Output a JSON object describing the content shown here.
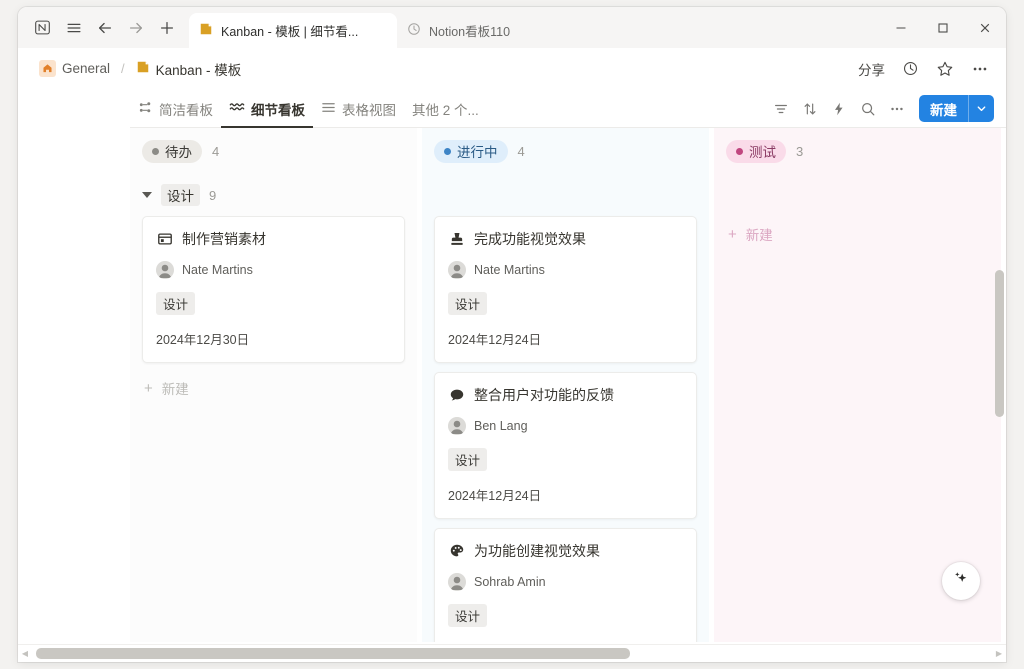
{
  "browser": {
    "nav": {
      "app_icon": "notion-logo-icon",
      "menu_icon": "hamburger-menu-icon",
      "back_icon": "back-arrow-icon",
      "forward_icon": "forward-arrow-icon",
      "newtab_icon": "plus-icon"
    },
    "tabs": [
      {
        "label": "Kanban - 模板 | 细节看...",
        "icon": "notion-page-icon",
        "active": true
      },
      {
        "label": "Notion看板110",
        "icon": "clock-icon",
        "active": false
      }
    ],
    "window_controls": {
      "minimize": "minimize-icon",
      "maximize": "maximize-icon",
      "close": "close-icon"
    }
  },
  "topbar": {
    "breadcrumb": {
      "home_emoji": "🏠",
      "workspace": "General",
      "separator": "/",
      "page_icon": "notion-page-icon",
      "page": "Kanban - 模板"
    },
    "share_label": "分享",
    "history_icon": "clock-icon",
    "favorite_icon": "star-icon",
    "more_icon": "more-horizontal-icon"
  },
  "viewbar": {
    "views": [
      {
        "label": "简洁看板",
        "icon": "board-simple-icon",
        "active": false
      },
      {
        "label": "细节看板",
        "icon": "board-detail-icon",
        "active": true
      },
      {
        "label": "表格视图",
        "icon": "table-icon",
        "active": false
      }
    ],
    "more_views_label": "其他 2 个...",
    "tools": [
      {
        "name": "filter-icon"
      },
      {
        "name": "sort-icon"
      },
      {
        "name": "automation-icon"
      },
      {
        "name": "search-icon"
      },
      {
        "name": "more-horizontal-icon"
      }
    ],
    "new_button": {
      "label": "新建",
      "caret": "chevron-down-icon",
      "color": "#2383e2"
    }
  },
  "board": {
    "add_new_label": "新建",
    "columns": [
      {
        "status": "待办",
        "count": "4",
        "pill_color": "#eceae6",
        "dot_color": "#8c8b86",
        "bg": "#fcfcfc",
        "group": {
          "name": "设计",
          "count": "9"
        },
        "cards": [
          {
            "icon": "image-icon",
            "title": "制作营销素材",
            "person": "Nate Martins",
            "tag": "设计",
            "date": "2024年12月30日"
          }
        ],
        "add_new_tint": "gray"
      },
      {
        "status": "进行中",
        "count": "4",
        "pill_color": "#dfeefb",
        "dot_color": "#3d84c6",
        "bg": "#f7fbfd",
        "group": null,
        "cards": [
          {
            "icon": "stamp-icon",
            "title": "完成功能视觉效果",
            "person": "Nate Martins",
            "tag": "设计",
            "date": "2024年12月24日"
          },
          {
            "icon": "speech-bubble-icon",
            "title": "整合用户对功能的反馈",
            "person": "Ben Lang",
            "tag": "设计",
            "date": "2024年12月24日"
          },
          {
            "icon": "palette-icon",
            "title": "为功能创建视觉效果",
            "person": "Sohrab Amin",
            "tag": "设计",
            "date": ""
          }
        ],
        "add_new_tint": "none"
      },
      {
        "status": "测试",
        "count": "3",
        "pill_color": "#fadbe9",
        "dot_color": "#c0467f",
        "bg": "#fdf5f8",
        "group": null,
        "cards": [],
        "add_new_tint": "pink"
      }
    ]
  },
  "ai_button": {
    "icon": "sparkle-icon"
  },
  "scrollbars": {
    "vertical": "vertical-scrollbar",
    "horizontal": "horizontal-scrollbar"
  }
}
